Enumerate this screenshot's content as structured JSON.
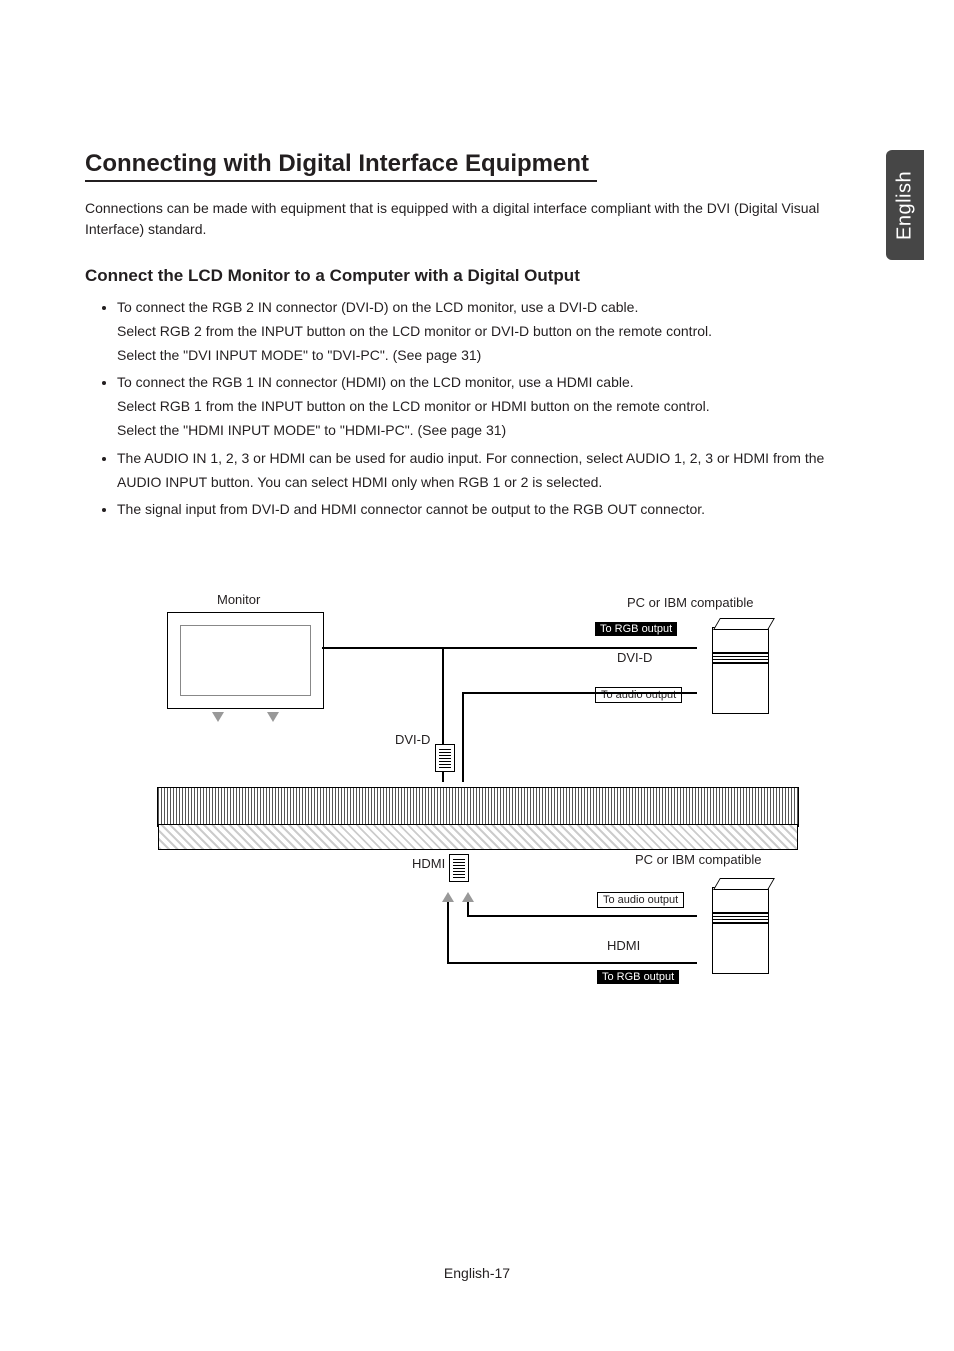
{
  "side_tab": "English",
  "main_title": "Connecting with Digital Interface Equipment",
  "intro": "Connections can be made with equipment that is equipped with a digital interface compliant with the DVI (Digital Visual Interface) standard.",
  "sub_title": "Connect the LCD Monitor to a Computer with a Digital Output",
  "bullets": [
    "To connect the RGB 2 IN connector (DVI-D) on the LCD monitor, use a DVI-D cable.\nSelect RGB 2 from the INPUT button on the LCD monitor or DVI-D button on the remote control.\nSelect the \"DVI INPUT MODE\" to \"DVI-PC\".  (See page 31)",
    "To connect the RGB 1 IN connector (HDMI) on the LCD monitor, use a HDMI cable.\nSelect RGB 1 from the INPUT button on the LCD monitor or HDMI button on the remote control.\nSelect the \"HDMI INPUT MODE\" to \"HDMI-PC\".  (See page 31)",
    "The AUDIO IN 1, 2, 3 or HDMI can be used for audio input. For connection, select AUDIO 1, 2, 3 or HDMI from the AUDIO INPUT button.  You can select HDMI only when RGB 1 or 2 is selected.",
    "The signal input from DVI-D and HDMI connector cannot be output to the RGB OUT connector."
  ],
  "diagram": {
    "monitor_label": "Monitor",
    "pc_label_1": "PC or IBM compatible",
    "pc_label_2": "PC or IBM compatible",
    "to_rgb_output_1": "To RGB output",
    "to_rgb_output_2": "To RGB output",
    "to_audio_output_1": "To audio output",
    "to_audio_output_2": "To audio output",
    "dvi_d_1": "DVI-D",
    "dvi_d_2": "DVI-D",
    "hdmi_1": "HDMI",
    "hdmi_2": "HDMI"
  },
  "footer": "English-17"
}
